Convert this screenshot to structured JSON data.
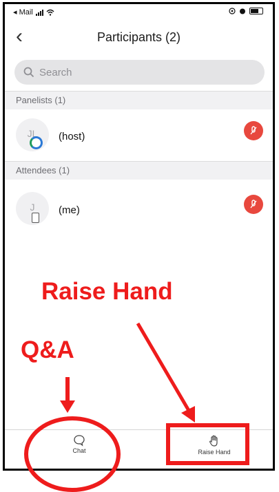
{
  "status_bar": {
    "carrier": "◂ Mail"
  },
  "header": {
    "title": "Participants (2)",
    "back_glyph": "‹"
  },
  "search": {
    "placeholder": "Search"
  },
  "sections": {
    "panelists": "Panelists (1)",
    "attendees": "Attendees (1)"
  },
  "participants": [
    {
      "initials": "JL",
      "name": "(host)",
      "mic": "muted",
      "device_icon": "zoom-ring-icon"
    },
    {
      "initials": "J",
      "name": "(me)",
      "mic": "muted",
      "device_icon": "phone-icon"
    }
  ],
  "annotations": {
    "raise_hand": "Raise Hand",
    "qa": "Q&A",
    "color": "#ee1c1c"
  },
  "tabbar": {
    "chat_label": "Chat",
    "raise_hand_label": "Raise Hand"
  },
  "colors": {
    "mic_muted": "#e8483e",
    "annotation": "#ee1c1c"
  }
}
